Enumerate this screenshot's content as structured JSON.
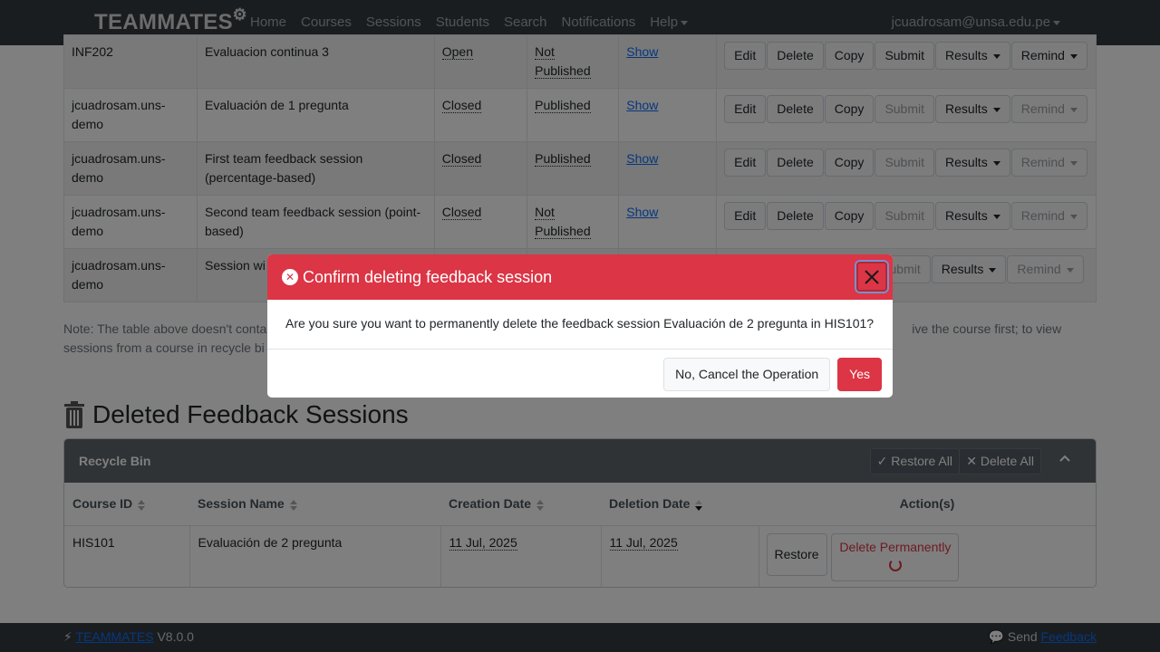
{
  "navbar": {
    "brand": "TEAMMATES",
    "items": [
      "Home",
      "Courses",
      "Sessions",
      "Students",
      "Search",
      "Notifications",
      "Help"
    ],
    "user": "jcuadrosam@unsa.edu.pe"
  },
  "sessions": [
    {
      "course": "INF202",
      "name": "Evaluacion continua 3",
      "status": "Open",
      "published": "Not Published",
      "link": "Show",
      "submit_enabled": true,
      "remind_enabled": true
    },
    {
      "course": "jcuadrosam.uns-demo",
      "name": "Evaluación de 1 pregunta",
      "status": "Closed",
      "published": "Published",
      "link": "Show",
      "submit_enabled": false,
      "remind_enabled": false
    },
    {
      "course": "jcuadrosam.uns-demo",
      "name": "First team feedback session (percentage-based)",
      "status": "Closed",
      "published": "Published",
      "link": "Show",
      "submit_enabled": false,
      "remind_enabled": false
    },
    {
      "course": "jcuadrosam.uns-demo",
      "name": "Second team feedback session (point-based)",
      "status": "Closed",
      "published": "Not Published",
      "link": "Show",
      "submit_enabled": false,
      "remind_enabled": false
    },
    {
      "course": "jcuadrosam.uns-demo",
      "name": "Session wi",
      "status": "",
      "published": "",
      "link": "",
      "submit_enabled": false,
      "remind_enabled": false
    }
  ],
  "row_buttons": {
    "edit": "Edit",
    "delete": "Delete",
    "copy": "Copy",
    "submit": "Submit",
    "results": "Results",
    "remind": "Remind"
  },
  "note": {
    "line1_left": "Note: The table above doesn't conta",
    "line1_right": "ive the course first; to view",
    "line2": "sessions from a course in recycle bi"
  },
  "deleted": {
    "title": "Deleted Feedback Sessions",
    "panel_title": "Recycle Bin",
    "restore_all": "Restore All",
    "delete_all": "Delete All",
    "headers": [
      "Course ID",
      "Session Name",
      "Creation Date",
      "Deletion Date",
      "Action(s)"
    ],
    "row": {
      "course": "HIS101",
      "name": "Evaluación de 2 pregunta",
      "created": "11 Jul, 2025",
      "deleted": "11 Jul, 2025",
      "restore": "Restore",
      "delete_perm": "Delete Permanently"
    }
  },
  "footer": {
    "brand": "TEAMMATES",
    "version": "V8.0.0",
    "send": "Send",
    "feedback": "Feedback"
  },
  "modal": {
    "title": "Confirm deleting feedback session",
    "body": "Are you sure you want to permanently delete the feedback session Evaluación de 2 pregunta in HIS101?",
    "cancel": "No, Cancel the Operation",
    "confirm": "Yes"
  },
  "colors": {
    "danger": "#dc3545",
    "navbar": "#343a40",
    "link": "#0d6efd"
  }
}
